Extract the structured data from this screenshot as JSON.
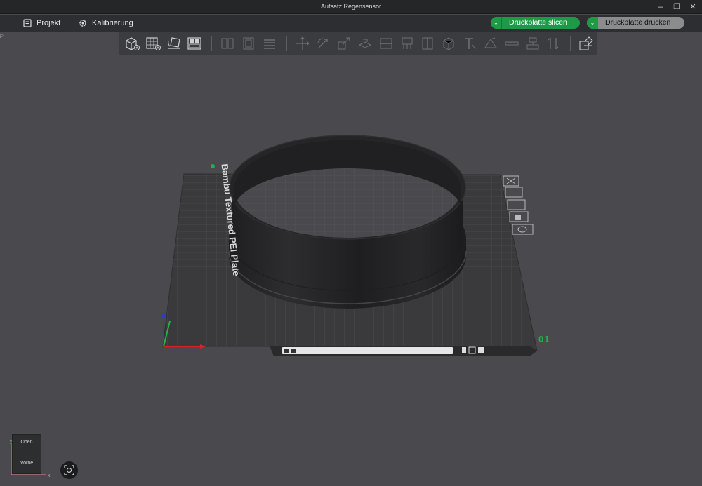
{
  "window": {
    "title": "Aufsatz Regensensor"
  },
  "menu": {
    "items": [
      {
        "label": "Projekt",
        "icon": "file-icon"
      },
      {
        "label": "Kalibrierung",
        "icon": "calibration-gear-icon"
      }
    ]
  },
  "actions": {
    "slice_label": "Druckplatte slicen",
    "print_label": "Druckplatte drucken"
  },
  "toolbar": {
    "groups": [
      [
        "add-cube",
        "add-plate-grid",
        "auto-orient",
        "arrange"
      ],
      [
        "split-objects",
        "split-parts",
        "layers"
      ],
      [
        "move",
        "rotate",
        "scale",
        "lay-on-face",
        "cut",
        "support-paint",
        "seam-paint",
        "color-paint",
        "mesh-boolean",
        "text",
        "measure",
        "assembly",
        "emboss",
        "variable-layer"
      ],
      [
        "assembly-view"
      ]
    ]
  },
  "plate": {
    "brand": "Bambu Textured PEI Plate",
    "number": "01",
    "side_icons": [
      "close-plate-icon",
      "plate-image-icon",
      "arrange-plate-icon",
      "lock-plate-icon",
      "plate-settings-icon"
    ]
  },
  "view_cube": {
    "top_label": "Oben",
    "front_label": "Vorne",
    "axis_x": "x",
    "axis_y": "y"
  },
  "colors": {
    "accent": "#1d9a47",
    "background": "#4a4a4e",
    "plate": "#3a3a3c"
  }
}
